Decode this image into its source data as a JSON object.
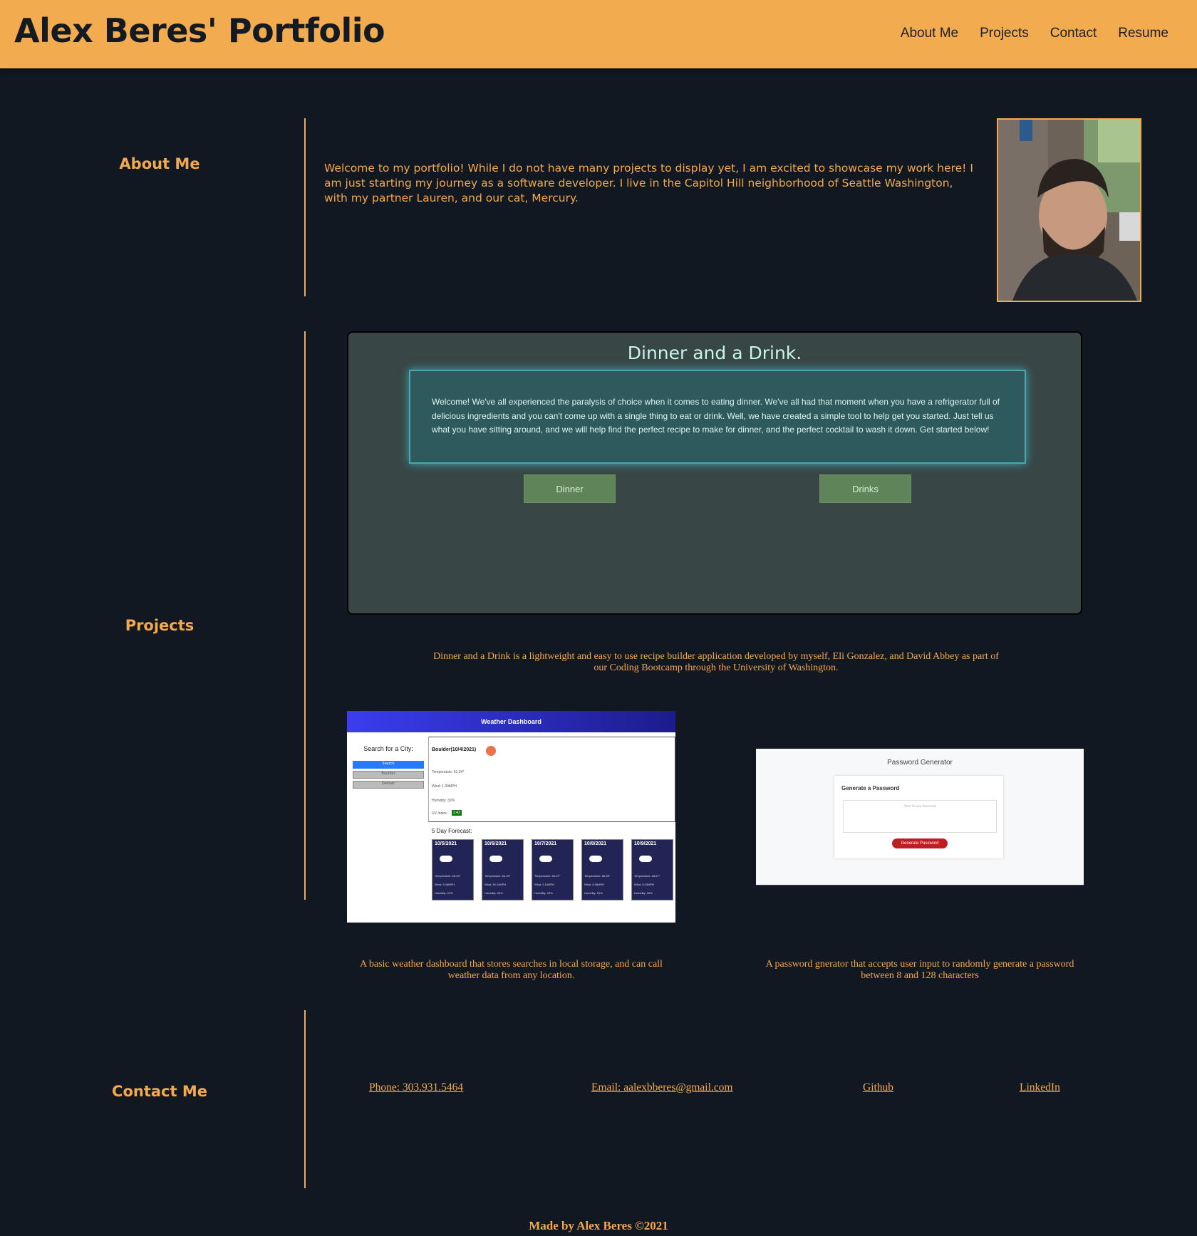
{
  "header": {
    "title": "Alex Beres' Portfolio",
    "nav": [
      "About Me",
      "Projects",
      "Contact",
      "Resume"
    ]
  },
  "about": {
    "heading": "About Me",
    "text": "Welcome to my portfolio! While I do not have many projects to display yet, I am excited to showcase my work here! I am just starting my journey as a software developer. I live in the Capitol Hill neighborhood of Seattle Washington, with my partner Lauren, and our cat, Mercury."
  },
  "projects": {
    "heading": "Projects",
    "dinner": {
      "title": "Dinner and a Drink.",
      "intro": "Welcome! We've all experienced the paralysis of choice when it comes to eating dinner. We've all had that moment when you have a refrigerator full of delicious ingredients and you can't come up with a single thing to eat or drink. Well, we have created a simple tool to help get you started. Just tell us what you have sitting around, and we will help find the perfect recipe to make for dinner, and the perfect cocktail to wash it down. Get started below!",
      "btn_dinner": "Dinner",
      "btn_drinks": "Drinks",
      "caption": "Dinner and a Drink is a lightweight and easy to use recipe builder application developed by myself, Eli Gonzalez, and David Abbey as part of our Coding Bootcamp through the University of Washington."
    },
    "weather": {
      "header": "Weather Dashboard",
      "search_label": "Search for a City:",
      "search_btn": "Search",
      "history": [
        "Boulder",
        "Denver"
      ],
      "city": "Boulder(10/4/2021)",
      "temp": "Temperature: 61.34°",
      "wind": "Wind: 1.99MPH",
      "humidity": "Humidity: 32%",
      "uv_label": "UV Index:",
      "uv_value": "2.42",
      "forecast_label": "5 Day Forecast:",
      "forecast": [
        {
          "date": "10/5/2021",
          "temp": "Temperature: 68.09°",
          "wind": "Wind: 8.46MPH",
          "hum": "Humidity: 23%"
        },
        {
          "date": "10/6/2021",
          "temp": "Temperature: 64.09°",
          "wind": "Wind: 16.14MPH",
          "hum": "Humidity: 26%"
        },
        {
          "date": "10/7/2021",
          "temp": "Temperature: 63.07°",
          "wind": "Wind: 9.16MPH",
          "hum": "Humidity: 23%"
        },
        {
          "date": "10/8/2021",
          "temp": "Temperature: 66.28°",
          "wind": "Wind: 8.98MPH",
          "hum": "Humidity: 26%"
        },
        {
          "date": "10/9/2021",
          "temp": "Temperature: 58.67°",
          "wind": "Wind: 6.03MPH",
          "hum": "Humidity: 35%"
        }
      ],
      "caption": "A basic weather dashboard that stores searches in local storage, and can call weather data from any location."
    },
    "password": {
      "title": "Password Generator",
      "card_heading": "Generate a Password",
      "placeholder": "Your Secure Password",
      "button": "Generate Password",
      "caption": "A password gnerator that accepts user input to randomly generate a password between 8 and 128 characters"
    }
  },
  "contact": {
    "heading": "Contact Me",
    "phone": "Phone: 303.931.5464",
    "email": "Email: aalexbberes@gmail.com",
    "github": "Github",
    "linkedin": "LinkedIn"
  },
  "footer": "Made by Alex Beres ©2021"
}
